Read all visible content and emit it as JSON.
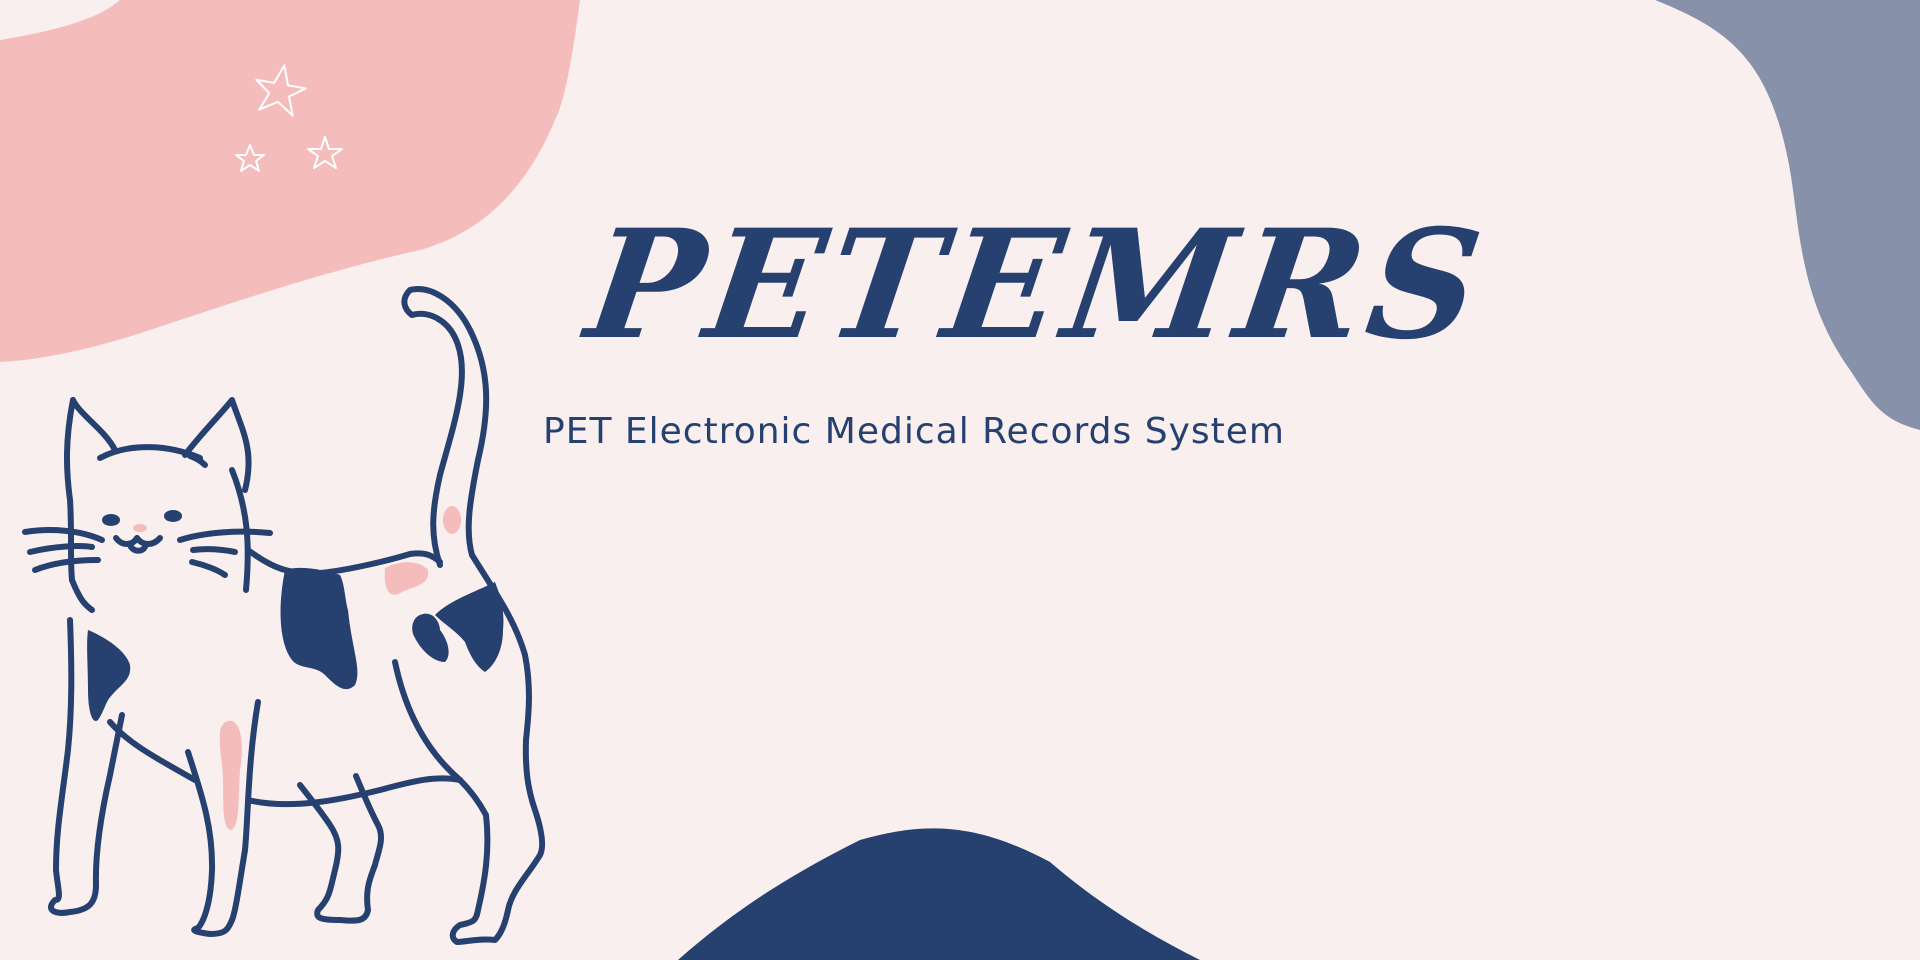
{
  "brand": {
    "title": "PETEMRS",
    "subtitle": "PET Electronic Medical Records System"
  },
  "palette": {
    "background": "#f9efef",
    "pink": "#f5bcbc",
    "navy": "#26416f",
    "slate": "#8792aa",
    "star": "#ffffff"
  },
  "decorations": {
    "illustration": "cat-illustration",
    "stars": "star-icons"
  }
}
